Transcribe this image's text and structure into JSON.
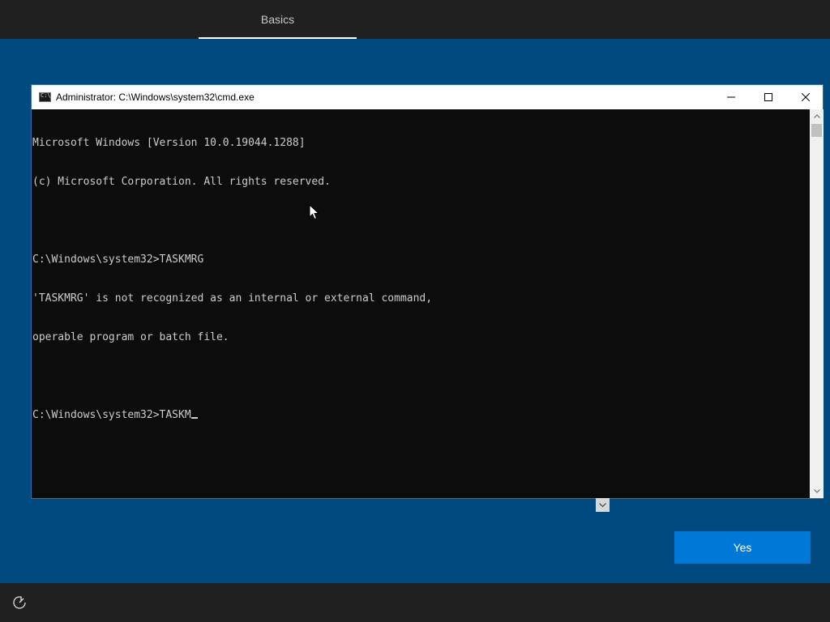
{
  "oobe": {
    "tab_label": "Basics",
    "yes_button_label": "Yes"
  },
  "cmd": {
    "title": "Administrator: C:\\Windows\\system32\\cmd.exe",
    "lines": [
      "Microsoft Windows [Version 10.0.19044.1288]",
      "(c) Microsoft Corporation. All rights reserved.",
      "",
      "C:\\Windows\\system32>TASKMRG",
      "'TASKMRG' is not recognized as an internal or external command,",
      "operable program or batch file.",
      "",
      "C:\\Windows\\system32>TASKM"
    ]
  },
  "icons": {
    "title": "cmd-icon",
    "minimize": "minimize-icon",
    "maximize": "maximize-icon",
    "close": "close-icon",
    "accessibility": "accessibility-icon",
    "expand": "chevron-down-icon",
    "pointer": "mouse-pointer-icon"
  },
  "colors": {
    "background": "#004a80",
    "accent": "#0078d7",
    "console_bg": "#0c0c0c",
    "console_fg": "#cccccc"
  }
}
